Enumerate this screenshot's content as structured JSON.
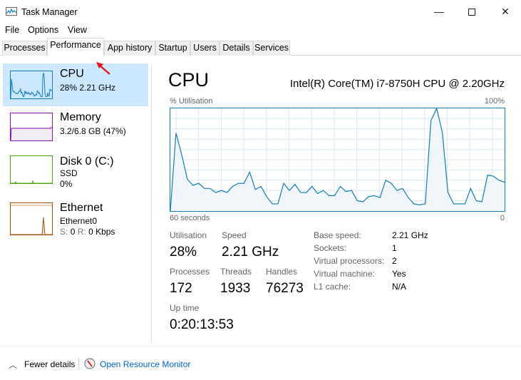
{
  "window": {
    "title": "Task Manager",
    "app_icon": "task-manager-icon",
    "controls": [
      "minimize-icon",
      "maximize-icon",
      "close-icon"
    ]
  },
  "menu": [
    "File",
    "Options",
    "View"
  ],
  "tabs": [
    {
      "label": "Processes"
    },
    {
      "label": "Performance",
      "selected": true
    },
    {
      "label": "App history"
    },
    {
      "label": "Startup"
    },
    {
      "label": "Users"
    },
    {
      "label": "Details"
    },
    {
      "label": "Services"
    }
  ],
  "sidebar": [
    {
      "name": "CPU",
      "line1": "28%  2.21 GHz",
      "color": "#117dbb",
      "selected": true
    },
    {
      "name": "Memory",
      "line1": "3.2/6.8 GB (47%)",
      "color": "#8b12ae",
      "level": 0.47
    },
    {
      "name": "Disk 0 (C:)",
      "line1": "SSD",
      "line2": "0%",
      "color": "#4da60c"
    },
    {
      "name": "Ethernet",
      "line1": "Ethernet0",
      "line2_label_s": "S:",
      "line2_val_s": "0",
      "line2_label_r": "R:",
      "line2_val_r": "0 Kbps",
      "color": "#a74f01"
    }
  ],
  "main": {
    "title": "CPU",
    "model": "Intel(R) Core(TM) i7-8750H CPU @ 2.20GHz",
    "stats": {
      "utilisation": {
        "label": "Utilisation",
        "value": "28%"
      },
      "speed": {
        "label": "Speed",
        "value": "2.21 GHz"
      },
      "processes": {
        "label": "Processes",
        "value": "172"
      },
      "threads": {
        "label": "Threads",
        "value": "1933"
      },
      "handles": {
        "label": "Handles",
        "value": "76273"
      },
      "uptime": {
        "label": "Up time",
        "value": "0:20:13:53"
      }
    },
    "details": [
      {
        "label": "Base speed:",
        "value": "2.21 GHz"
      },
      {
        "label": "Sockets:",
        "value": "1"
      },
      {
        "label": "Virtual processors:",
        "value": "2"
      },
      {
        "label": "Virtual machine:",
        "value": "Yes"
      },
      {
        "label": "L1 cache:",
        "value": "N/A"
      }
    ]
  },
  "chart_data": {
    "type": "area",
    "ylabel": "% Utilisation",
    "ymax_label": "100%",
    "x_start_label": "60 seconds",
    "x_end_label": "0",
    "ylim": [
      0,
      100
    ],
    "grid": true,
    "color": "#117dbb",
    "values": [
      0,
      76,
      55,
      31,
      25,
      27,
      22,
      22,
      18,
      20,
      18,
      24,
      27,
      27,
      38,
      21,
      24,
      14,
      7,
      7,
      27,
      20,
      26,
      18,
      18,
      24,
      17,
      20,
      15,
      15,
      24,
      19,
      20,
      10,
      9,
      14,
      15,
      13,
      30,
      27,
      20,
      22,
      13,
      7,
      6,
      7,
      88,
      100,
      77,
      18,
      7,
      7,
      7,
      22,
      10,
      9,
      35,
      34,
      30,
      28
    ]
  },
  "footer": {
    "fewer_details": "Fewer details",
    "open_monitor": "Open Resource Monitor",
    "link_color": "#0066cc"
  }
}
